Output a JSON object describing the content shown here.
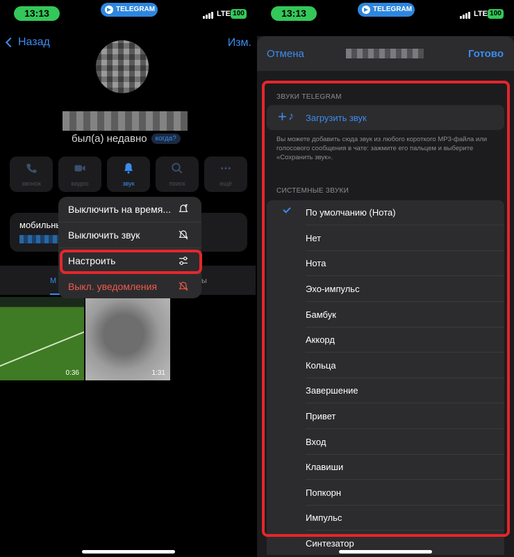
{
  "status_bar": {
    "time": "13:13",
    "app_badge": "TELEGRAM",
    "network": "LTE",
    "battery": "100"
  },
  "profile": {
    "back_label": "Назад",
    "edit_label": "Изм.",
    "status_text": "был(а) недавно",
    "when_badge": "когда?",
    "actions": [
      {
        "label": "звонок",
        "icon": "phone-icon"
      },
      {
        "label": "видео",
        "icon": "video-icon"
      },
      {
        "label": "звук",
        "icon": "bell-icon"
      },
      {
        "label": "поиск",
        "icon": "search-icon"
      },
      {
        "label": "ещё",
        "icon": "more-icon"
      }
    ],
    "phone_label": "мобильный",
    "tab_left_partial": "М",
    "tab_right_partial": "ы",
    "media": [
      {
        "duration": "0:36"
      },
      {
        "duration": "1:31"
      }
    ]
  },
  "context_menu": {
    "items": [
      {
        "label": "Выключить на время...",
        "icon": "bell-clock-icon"
      },
      {
        "label": "Выключить звук",
        "icon": "bell-slash-icon"
      },
      {
        "label": "Настроить",
        "icon": "sliders-icon"
      },
      {
        "label": "Выкл. уведомления",
        "icon": "bell-off-icon"
      }
    ]
  },
  "sound_sheet": {
    "cancel_label": "Отмена",
    "done_label": "Готово",
    "telegram_section": "ЗВУКИ TELEGRAM",
    "upload_label": "Загрузить звук",
    "hint": "Вы можете добавить сюда звук из любого короткого MP3-файла или голосового сообщения в чате: зажмите его пальцем и выберите «Сохранить звук».",
    "system_section": "СИСТЕМНЫЕ ЗВУКИ",
    "sounds": [
      {
        "label": "По умолчанию (Нота)",
        "selected": true
      },
      {
        "label": "Нет"
      },
      {
        "label": "Нота"
      },
      {
        "label": "Эхо-импульс"
      },
      {
        "label": "Бамбук"
      },
      {
        "label": "Аккорд"
      },
      {
        "label": "Кольца"
      },
      {
        "label": "Завершение"
      },
      {
        "label": "Привет"
      },
      {
        "label": "Вход"
      },
      {
        "label": "Клавиши"
      },
      {
        "label": "Попкорн"
      },
      {
        "label": "Импульс"
      },
      {
        "label": "Синтезатор"
      }
    ]
  },
  "colors": {
    "accent": "#3b8cf0",
    "highlight": "#e5262c",
    "danger": "#ef5a4f",
    "time_pill": "#34c759"
  }
}
